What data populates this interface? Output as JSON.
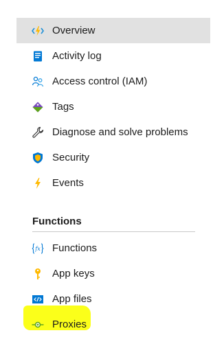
{
  "nav": {
    "items": [
      {
        "label": "Overview",
        "icon": "lightning-code-icon"
      },
      {
        "label": "Activity log",
        "icon": "activity-log-icon"
      },
      {
        "label": "Access control (IAM)",
        "icon": "users-icon"
      },
      {
        "label": "Tags",
        "icon": "tag-icon"
      },
      {
        "label": "Diagnose and solve problems",
        "icon": "wrench-icon"
      },
      {
        "label": "Security",
        "icon": "shield-icon"
      },
      {
        "label": "Events",
        "icon": "bolt-icon"
      }
    ],
    "selected_index": 0
  },
  "functions_section": {
    "title": "Functions",
    "items": [
      {
        "label": "Functions",
        "icon": "function-fx-icon"
      },
      {
        "label": "App keys",
        "icon": "key-icon"
      },
      {
        "label": "App files",
        "icon": "code-file-icon"
      },
      {
        "label": "Proxies",
        "icon": "proxy-icon"
      }
    ]
  },
  "colors": {
    "selected_bg": "#e1e1e1",
    "highlight": "#fbff1a",
    "azure_blue": "#0078d4",
    "bolt_yellow": "#ffb900",
    "proxy_green": "#5ea51c"
  }
}
